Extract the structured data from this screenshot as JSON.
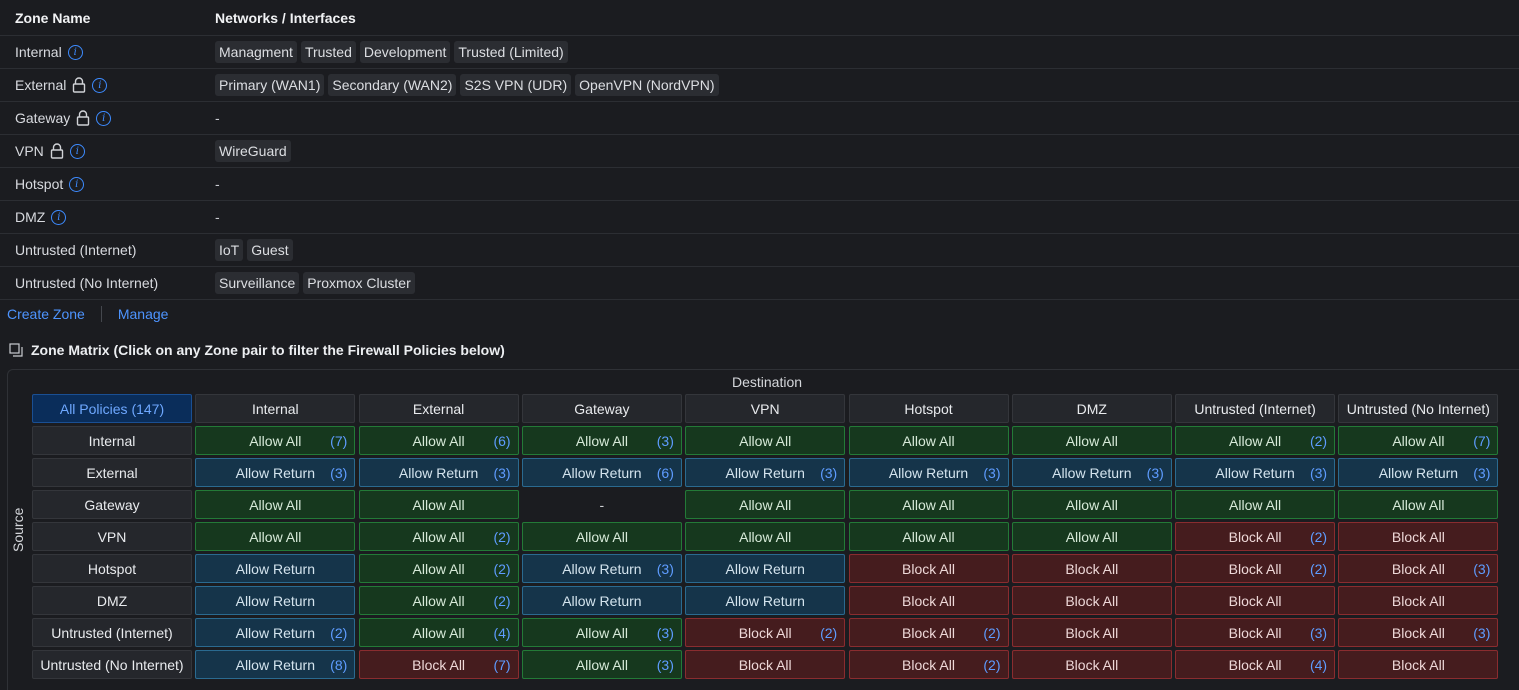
{
  "zones_table": {
    "col_zone_name": "Zone Name",
    "col_networks": "Networks / Interfaces",
    "rows": [
      {
        "name": "Internal",
        "locked": false,
        "networks": [
          "Managment",
          "Trusted",
          "Development",
          "Trusted (Limited)"
        ]
      },
      {
        "name": "External",
        "locked": true,
        "networks": [
          "Primary (WAN1)",
          "Secondary (WAN2)",
          "S2S VPN (UDR)",
          "OpenVPN (NordVPN)"
        ]
      },
      {
        "name": "Gateway",
        "locked": true,
        "networks": []
      },
      {
        "name": "VPN",
        "locked": true,
        "networks": [
          "WireGuard"
        ]
      },
      {
        "name": "Hotspot",
        "locked": false,
        "networks": []
      },
      {
        "name": "DMZ",
        "locked": false,
        "networks": []
      },
      {
        "name": "Untrusted (Internet)",
        "locked": false,
        "info": false,
        "networks": [
          "IoT",
          "Guest"
        ]
      },
      {
        "name": "Untrusted (No Internet)",
        "locked": false,
        "info": false,
        "networks": [
          "Surveillance",
          "Proxmox Cluster"
        ]
      }
    ],
    "empty_placeholder": "-"
  },
  "actions": {
    "create_zone": "Create Zone",
    "manage": "Manage"
  },
  "matrix": {
    "title": "Zone Matrix (Click on any Zone pair to filter the Firewall Policies below)",
    "destination_label": "Destination",
    "source_label": "Source",
    "all_policies": "All Policies (147)",
    "columns": [
      "Internal",
      "External",
      "Gateway",
      "VPN",
      "Hotspot",
      "DMZ",
      "Untrusted (Internet)",
      "Untrusted (No Internet)"
    ],
    "rows": [
      {
        "source": "Internal",
        "cells": [
          {
            "label": "Allow All",
            "type": "allow",
            "count": "(7)"
          },
          {
            "label": "Allow All",
            "type": "allow",
            "count": "(6)"
          },
          {
            "label": "Allow All",
            "type": "allow",
            "count": "(3)"
          },
          {
            "label": "Allow All",
            "type": "allow",
            "count": ""
          },
          {
            "label": "Allow All",
            "type": "allow",
            "count": ""
          },
          {
            "label": "Allow All",
            "type": "allow",
            "count": ""
          },
          {
            "label": "Allow All",
            "type": "allow",
            "count": "(2)"
          },
          {
            "label": "Allow All",
            "type": "allow",
            "count": "(7)"
          }
        ]
      },
      {
        "source": "External",
        "cells": [
          {
            "label": "Allow Return",
            "type": "ret",
            "count": "(3)"
          },
          {
            "label": "Allow Return",
            "type": "ret",
            "count": "(3)"
          },
          {
            "label": "Allow Return",
            "type": "ret",
            "count": "(6)"
          },
          {
            "label": "Allow Return",
            "type": "ret",
            "count": "(3)"
          },
          {
            "label": "Allow Return",
            "type": "ret",
            "count": "(3)"
          },
          {
            "label": "Allow Return",
            "type": "ret",
            "count": "(3)"
          },
          {
            "label": "Allow Return",
            "type": "ret",
            "count": "(3)"
          },
          {
            "label": "Allow Return",
            "type": "ret",
            "count": "(3)"
          }
        ]
      },
      {
        "source": "Gateway",
        "cells": [
          {
            "label": "Allow All",
            "type": "allow",
            "count": ""
          },
          {
            "label": "Allow All",
            "type": "allow",
            "count": ""
          },
          {
            "label": "-",
            "type": "none",
            "count": ""
          },
          {
            "label": "Allow All",
            "type": "allow",
            "count": ""
          },
          {
            "label": "Allow All",
            "type": "allow",
            "count": ""
          },
          {
            "label": "Allow All",
            "type": "allow",
            "count": ""
          },
          {
            "label": "Allow All",
            "type": "allow",
            "count": ""
          },
          {
            "label": "Allow All",
            "type": "allow",
            "count": ""
          }
        ]
      },
      {
        "source": "VPN",
        "cells": [
          {
            "label": "Allow All",
            "type": "allow",
            "count": ""
          },
          {
            "label": "Allow All",
            "type": "allow",
            "count": "(2)"
          },
          {
            "label": "Allow All",
            "type": "allow",
            "count": ""
          },
          {
            "label": "Allow All",
            "type": "allow",
            "count": ""
          },
          {
            "label": "Allow All",
            "type": "allow",
            "count": ""
          },
          {
            "label": "Allow All",
            "type": "allow",
            "count": ""
          },
          {
            "label": "Block All",
            "type": "block",
            "count": "(2)"
          },
          {
            "label": "Block All",
            "type": "block",
            "count": ""
          }
        ]
      },
      {
        "source": "Hotspot",
        "cells": [
          {
            "label": "Allow Return",
            "type": "ret",
            "count": ""
          },
          {
            "label": "Allow All",
            "type": "allow",
            "count": "(2)"
          },
          {
            "label": "Allow Return",
            "type": "ret",
            "count": "(3)"
          },
          {
            "label": "Allow Return",
            "type": "ret",
            "count": ""
          },
          {
            "label": "Block All",
            "type": "block",
            "count": ""
          },
          {
            "label": "Block All",
            "type": "block",
            "count": ""
          },
          {
            "label": "Block All",
            "type": "block",
            "count": "(2)"
          },
          {
            "label": "Block All",
            "type": "block",
            "count": "(3)"
          }
        ]
      },
      {
        "source": "DMZ",
        "cells": [
          {
            "label": "Allow Return",
            "type": "ret",
            "count": ""
          },
          {
            "label": "Allow All",
            "type": "allow",
            "count": "(2)"
          },
          {
            "label": "Allow Return",
            "type": "ret",
            "count": ""
          },
          {
            "label": "Allow Return",
            "type": "ret",
            "count": ""
          },
          {
            "label": "Block All",
            "type": "block",
            "count": ""
          },
          {
            "label": "Block All",
            "type": "block",
            "count": ""
          },
          {
            "label": "Block All",
            "type": "block",
            "count": ""
          },
          {
            "label": "Block All",
            "type": "block",
            "count": ""
          }
        ]
      },
      {
        "source": "Untrusted (Internet)",
        "cells": [
          {
            "label": "Allow Return",
            "type": "ret",
            "count": "(2)"
          },
          {
            "label": "Allow All",
            "type": "allow",
            "count": "(4)"
          },
          {
            "label": "Allow All",
            "type": "allow",
            "count": "(3)"
          },
          {
            "label": "Block All",
            "type": "block",
            "count": "(2)"
          },
          {
            "label": "Block All",
            "type": "block",
            "count": "(2)"
          },
          {
            "label": "Block All",
            "type": "block",
            "count": ""
          },
          {
            "label": "Block All",
            "type": "block",
            "count": "(3)"
          },
          {
            "label": "Block All",
            "type": "block",
            "count": "(3)"
          }
        ]
      },
      {
        "source": "Untrusted (No Internet)",
        "cells": [
          {
            "label": "Allow Return",
            "type": "ret",
            "count": "(8)"
          },
          {
            "label": "Block All",
            "type": "block",
            "count": "(7)"
          },
          {
            "label": "Allow All",
            "type": "allow",
            "count": "(3)"
          },
          {
            "label": "Block All",
            "type": "block",
            "count": ""
          },
          {
            "label": "Block All",
            "type": "block",
            "count": "(2)"
          },
          {
            "label": "Block All",
            "type": "block",
            "count": ""
          },
          {
            "label": "Block All",
            "type": "block",
            "count": "(4)"
          },
          {
            "label": "Block All",
            "type": "block",
            "count": ""
          }
        ]
      }
    ]
  }
}
